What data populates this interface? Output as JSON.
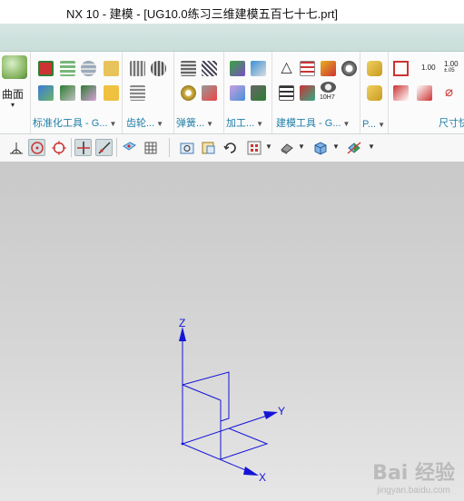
{
  "window": {
    "title": "NX 10 - 建模 - [UG10.0练习三维建模五百七十七.prt]"
  },
  "ribbon": {
    "surface_button_label": "曲面",
    "groups": [
      {
        "label": "标准化工具 - G..."
      },
      {
        "label": "齿轮..."
      },
      {
        "label": "弹簧..."
      },
      {
        "label": "加工..."
      },
      {
        "label": "建模工具 - G..."
      },
      {
        "label": "P..."
      },
      {
        "label": "尺寸快"
      }
    ],
    "icon_texts": {
      "fit_tolerance": "10H7",
      "dim_100": "1.00",
      "dim_100_tol": "1.00",
      "dim_100_tol_sub": "±.05"
    }
  },
  "viewport": {
    "axes": {
      "z": "Z",
      "y": "Y",
      "x": "X"
    },
    "colors": {
      "axis": "#1414d8",
      "background_top": "#c9c9c9",
      "background_bottom": "#e6e6e6"
    }
  },
  "watermark": {
    "brand": "Bai 经验",
    "url": "jingyan.baidu.com"
  }
}
